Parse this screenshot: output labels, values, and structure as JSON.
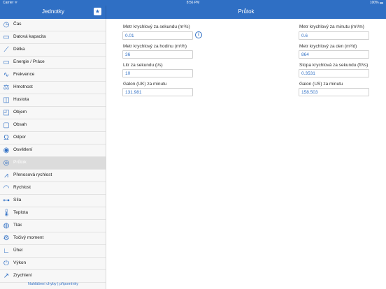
{
  "statusbar": {
    "carrier": "Carrier ᯤ",
    "time": "8:56 PM",
    "battery": "100% ▬"
  },
  "sidebar": {
    "title": "Jednotky",
    "star_icon": "star-icon",
    "items": [
      {
        "label": "Čas",
        "icon": "clock-icon",
        "glyph": "◷"
      },
      {
        "label": "Datová kapacita",
        "icon": "data-capacity-icon",
        "glyph": "▭"
      },
      {
        "label": "Délka",
        "icon": "ruler-icon",
        "glyph": "⟋"
      },
      {
        "label": "Energie / Práce",
        "icon": "battery-icon",
        "glyph": "▭"
      },
      {
        "label": "Frekvence",
        "icon": "frequency-icon",
        "glyph": "∿"
      },
      {
        "label": "Hmotnost",
        "icon": "weight-icon",
        "glyph": "⚖"
      },
      {
        "label": "Hustota",
        "icon": "density-icon",
        "glyph": "◫"
      },
      {
        "label": "Objem",
        "icon": "volume-icon",
        "glyph": "◰"
      },
      {
        "label": "Obsah",
        "icon": "area-icon",
        "glyph": "▢"
      },
      {
        "label": "Odpor",
        "icon": "resistance-icon",
        "glyph": "Ω"
      },
      {
        "label": "Osvětlení",
        "icon": "bulb-icon",
        "glyph": "◉"
      },
      {
        "label": "Průtok",
        "icon": "flow-icon",
        "glyph": "◎"
      },
      {
        "label": "Přenosová rychlost",
        "icon": "transfer-rate-icon",
        "glyph": "⩘"
      },
      {
        "label": "Rychlost",
        "icon": "speedometer-icon",
        "glyph": "◠"
      },
      {
        "label": "Síla",
        "icon": "force-icon",
        "glyph": "⊶"
      },
      {
        "label": "Teplota",
        "icon": "thermometer-icon",
        "glyph": "🌡"
      },
      {
        "label": "Tlak",
        "icon": "pressure-icon",
        "glyph": "◍"
      },
      {
        "label": "Točivý moment",
        "icon": "torque-icon",
        "glyph": "⚙"
      },
      {
        "label": "Úhel",
        "icon": "angle-icon",
        "glyph": "∟"
      },
      {
        "label": "Výkon",
        "icon": "power-icon",
        "glyph": "⏻"
      },
      {
        "label": "Zrychlení",
        "icon": "acceleration-icon",
        "glyph": "↗"
      }
    ],
    "selected_index": 11,
    "report_link": "Nahlášení chyby | připomínky"
  },
  "main": {
    "title": "Průtok",
    "fields": [
      {
        "label": "Metr krychlový za sekundu (m³/s)",
        "value": "0.01"
      },
      {
        "label": "Metr krychlový za hodinu (m³/h)",
        "value": "36"
      },
      {
        "label": "Litr za sekundu (l/s)",
        "value": "10"
      },
      {
        "label": "Galon (UK) za minutu",
        "value": "131.981"
      },
      {
        "label": "Metr krychlový za minutu (m³/m)",
        "value": "0.6"
      },
      {
        "label": "Metr krychlový za den (m³/d)",
        "value": "864"
      },
      {
        "label": "Stopa krychlová za sekundu (ft³/s)",
        "value": "0.3531"
      },
      {
        "label": "Galon (US) za minutu",
        "value": "158.503"
      }
    ],
    "info_icon": "info-icon",
    "info_glyph": "i"
  },
  "colors": {
    "accent": "#2f6fc4",
    "sidebar_bg": "#f7f7f7",
    "selected_bg": "#dcdcdc"
  }
}
